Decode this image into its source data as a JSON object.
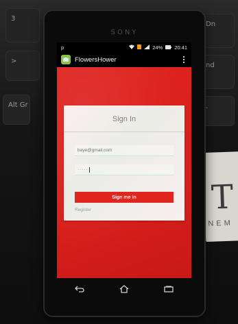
{
  "background": {
    "brand_text": "SONY",
    "card_text": "T",
    "card_subtext": "NEM"
  },
  "status_bar": {
    "left_icon": "p",
    "battery_percent": "24%",
    "time": "20:41"
  },
  "action_bar": {
    "app_name": "FlowersHower",
    "app_icon": "android-icon",
    "menu_icon": "overflow-menu-icon"
  },
  "login": {
    "title": "Sign In",
    "email_value": "baye@gmail.com",
    "password_value": "·····",
    "signin_button_label": "Sign me in",
    "register_link": "Register"
  },
  "colors": {
    "screen_red": "#d9201c",
    "button_red": "#e1251f",
    "card_bg": "#f4f8f5"
  },
  "nav_bar": {
    "back_icon": "back-icon",
    "home_icon": "home-icon",
    "recents_icon": "recents-icon"
  }
}
